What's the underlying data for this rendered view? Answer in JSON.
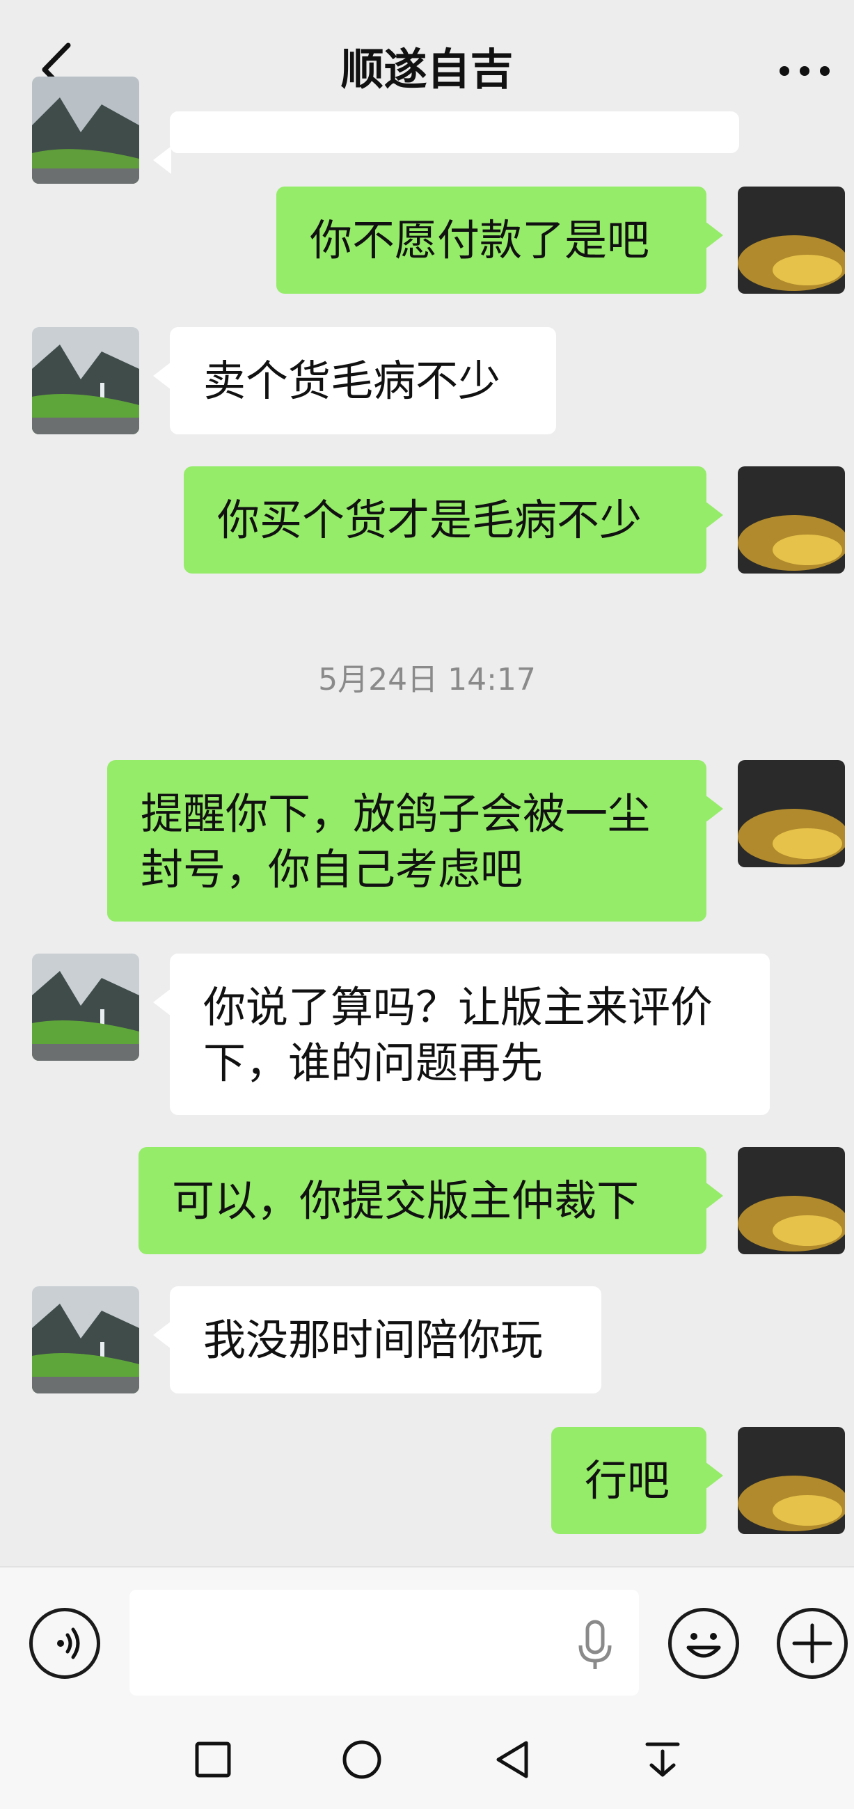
{
  "header": {
    "title": "顺遂自吉",
    "back_icon": "chevron-left-icon",
    "more_icon": "more-dots-icon"
  },
  "messages": [
    {
      "side": "in",
      "text": "",
      "partial": true
    },
    {
      "side": "out",
      "text": "你不愿付款了是吧"
    },
    {
      "side": "in",
      "text": "卖个货毛病不少"
    },
    {
      "side": "out",
      "text": "你买个货才是毛病不少"
    },
    {
      "type": "timestamp",
      "text": "5月24日 14:17"
    },
    {
      "side": "out",
      "text": "提醒你下，放鸽子会被一尘封号，你自己考虑吧"
    },
    {
      "side": "in",
      "text": "你说了算吗？让版主来评价下，谁的问题再先"
    },
    {
      "side": "out",
      "text": "可以，你提交版主仲裁下"
    },
    {
      "side": "in",
      "text": "我没那时间陪你玩"
    },
    {
      "side": "out",
      "text": "行吧"
    }
  ],
  "input_bar": {
    "voice_icon": "voice-mode-icon",
    "mic_icon": "microphone-icon",
    "emoji_icon": "emoji-icon",
    "plus_icon": "plus-icon",
    "message_value": ""
  },
  "navbar": {
    "icons": [
      "square-recent-icon",
      "circle-home-icon",
      "triangle-back-icon",
      "down-menu-icon"
    ]
  },
  "colors": {
    "background": "#ededed",
    "outgoing_bubble": "#95ec69",
    "incoming_bubble": "#ffffff"
  }
}
